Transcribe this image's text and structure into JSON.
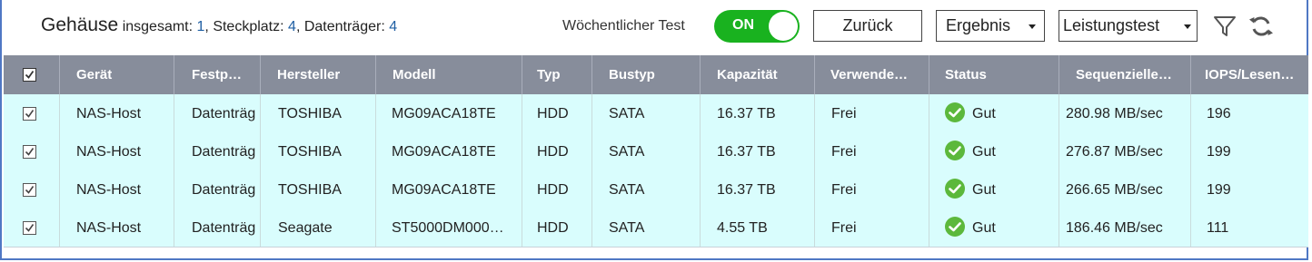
{
  "summary": {
    "title": "Gehäuse",
    "total_label": "insgesamt:",
    "total_value": "1",
    "slot_label": "Steckplatz:",
    "slot_value": "4",
    "disk_label": "Datenträger:",
    "disk_value": "4"
  },
  "toolbar": {
    "weekly_test_label": "Wöchentlicher Test",
    "toggle_state": "ON",
    "back_label": "Zurück",
    "result_label": "Ergebnis",
    "perf_test_label": "Leistungstest",
    "filter_icon": "filter-icon",
    "refresh_icon": "refresh-icon"
  },
  "colors": {
    "toggle_on": "#19b21f",
    "header_bg": "#878d9b",
    "row_bg": "#d9fdfd",
    "status_ok": "#5cb83c",
    "frame_border": "#4f78c4",
    "value_blue": "#1f5fa3"
  },
  "table": {
    "columns": [
      "Gerät",
      "Festp…",
      "Hersteller",
      "Modell",
      "Typ",
      "Bustyp",
      "Kapazität",
      "Verwende…",
      "Status",
      "Sequenzielle…",
      "IOPS/Lesen…"
    ],
    "rows": [
      {
        "checked": true,
        "cells": [
          "NAS-Host",
          "Datenträg",
          "TOSHIBA",
          "MG09ACA18TE",
          "HDD",
          "SATA",
          "16.37 TB",
          "Frei",
          "Gut",
          "280.98 MB/sec",
          "196"
        ]
      },
      {
        "checked": true,
        "cells": [
          "NAS-Host",
          "Datenträg",
          "TOSHIBA",
          "MG09ACA18TE",
          "HDD",
          "SATA",
          "16.37 TB",
          "Frei",
          "Gut",
          "276.87 MB/sec",
          "199"
        ]
      },
      {
        "checked": true,
        "cells": [
          "NAS-Host",
          "Datenträg",
          "TOSHIBA",
          "MG09ACA18TE",
          "HDD",
          "SATA",
          "16.37 TB",
          "Frei",
          "Gut",
          "266.65 MB/sec",
          "199"
        ]
      },
      {
        "checked": true,
        "cells": [
          "NAS-Host",
          "Datenträg",
          "Seagate",
          "ST5000DM000…",
          "HDD",
          "SATA",
          "4.55 TB",
          "Frei",
          "Gut",
          "186.46 MB/sec",
          "111"
        ]
      }
    ]
  }
}
